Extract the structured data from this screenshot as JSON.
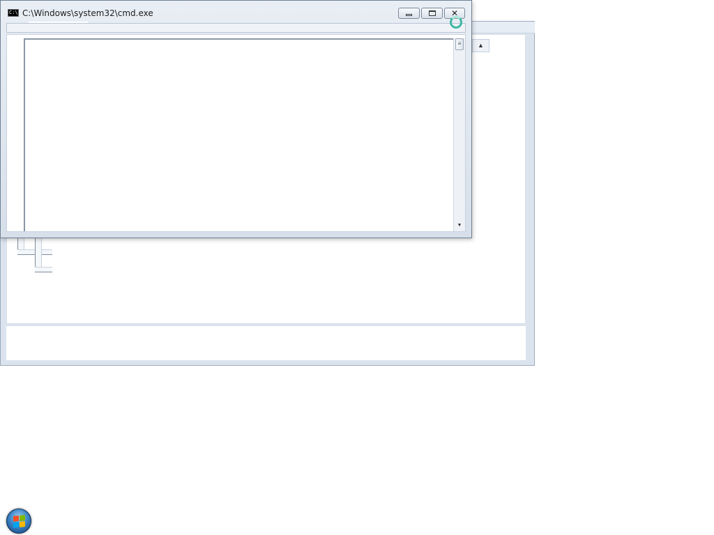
{
  "cmd_window": {
    "title": "C:\\Windows\\system32\\cmd.exe",
    "icon_label": "C:\\",
    "icon": "console-icon",
    "caption_buttons": {
      "minimize_icon": "minimize-icon",
      "maximize_icon": "maximize-icon",
      "close_icon": "close-icon",
      "close_glyph": "✕"
    },
    "scrollbar": {
      "thumb_glyph": "≡",
      "down_glyph": "▼"
    }
  },
  "background_window": {
    "scroll_up_glyph": "▲"
  },
  "taskbar": {
    "start_icon": "windows-start-orb-icon"
  },
  "cursor": {
    "icon": "busy-cursor-icon"
  }
}
